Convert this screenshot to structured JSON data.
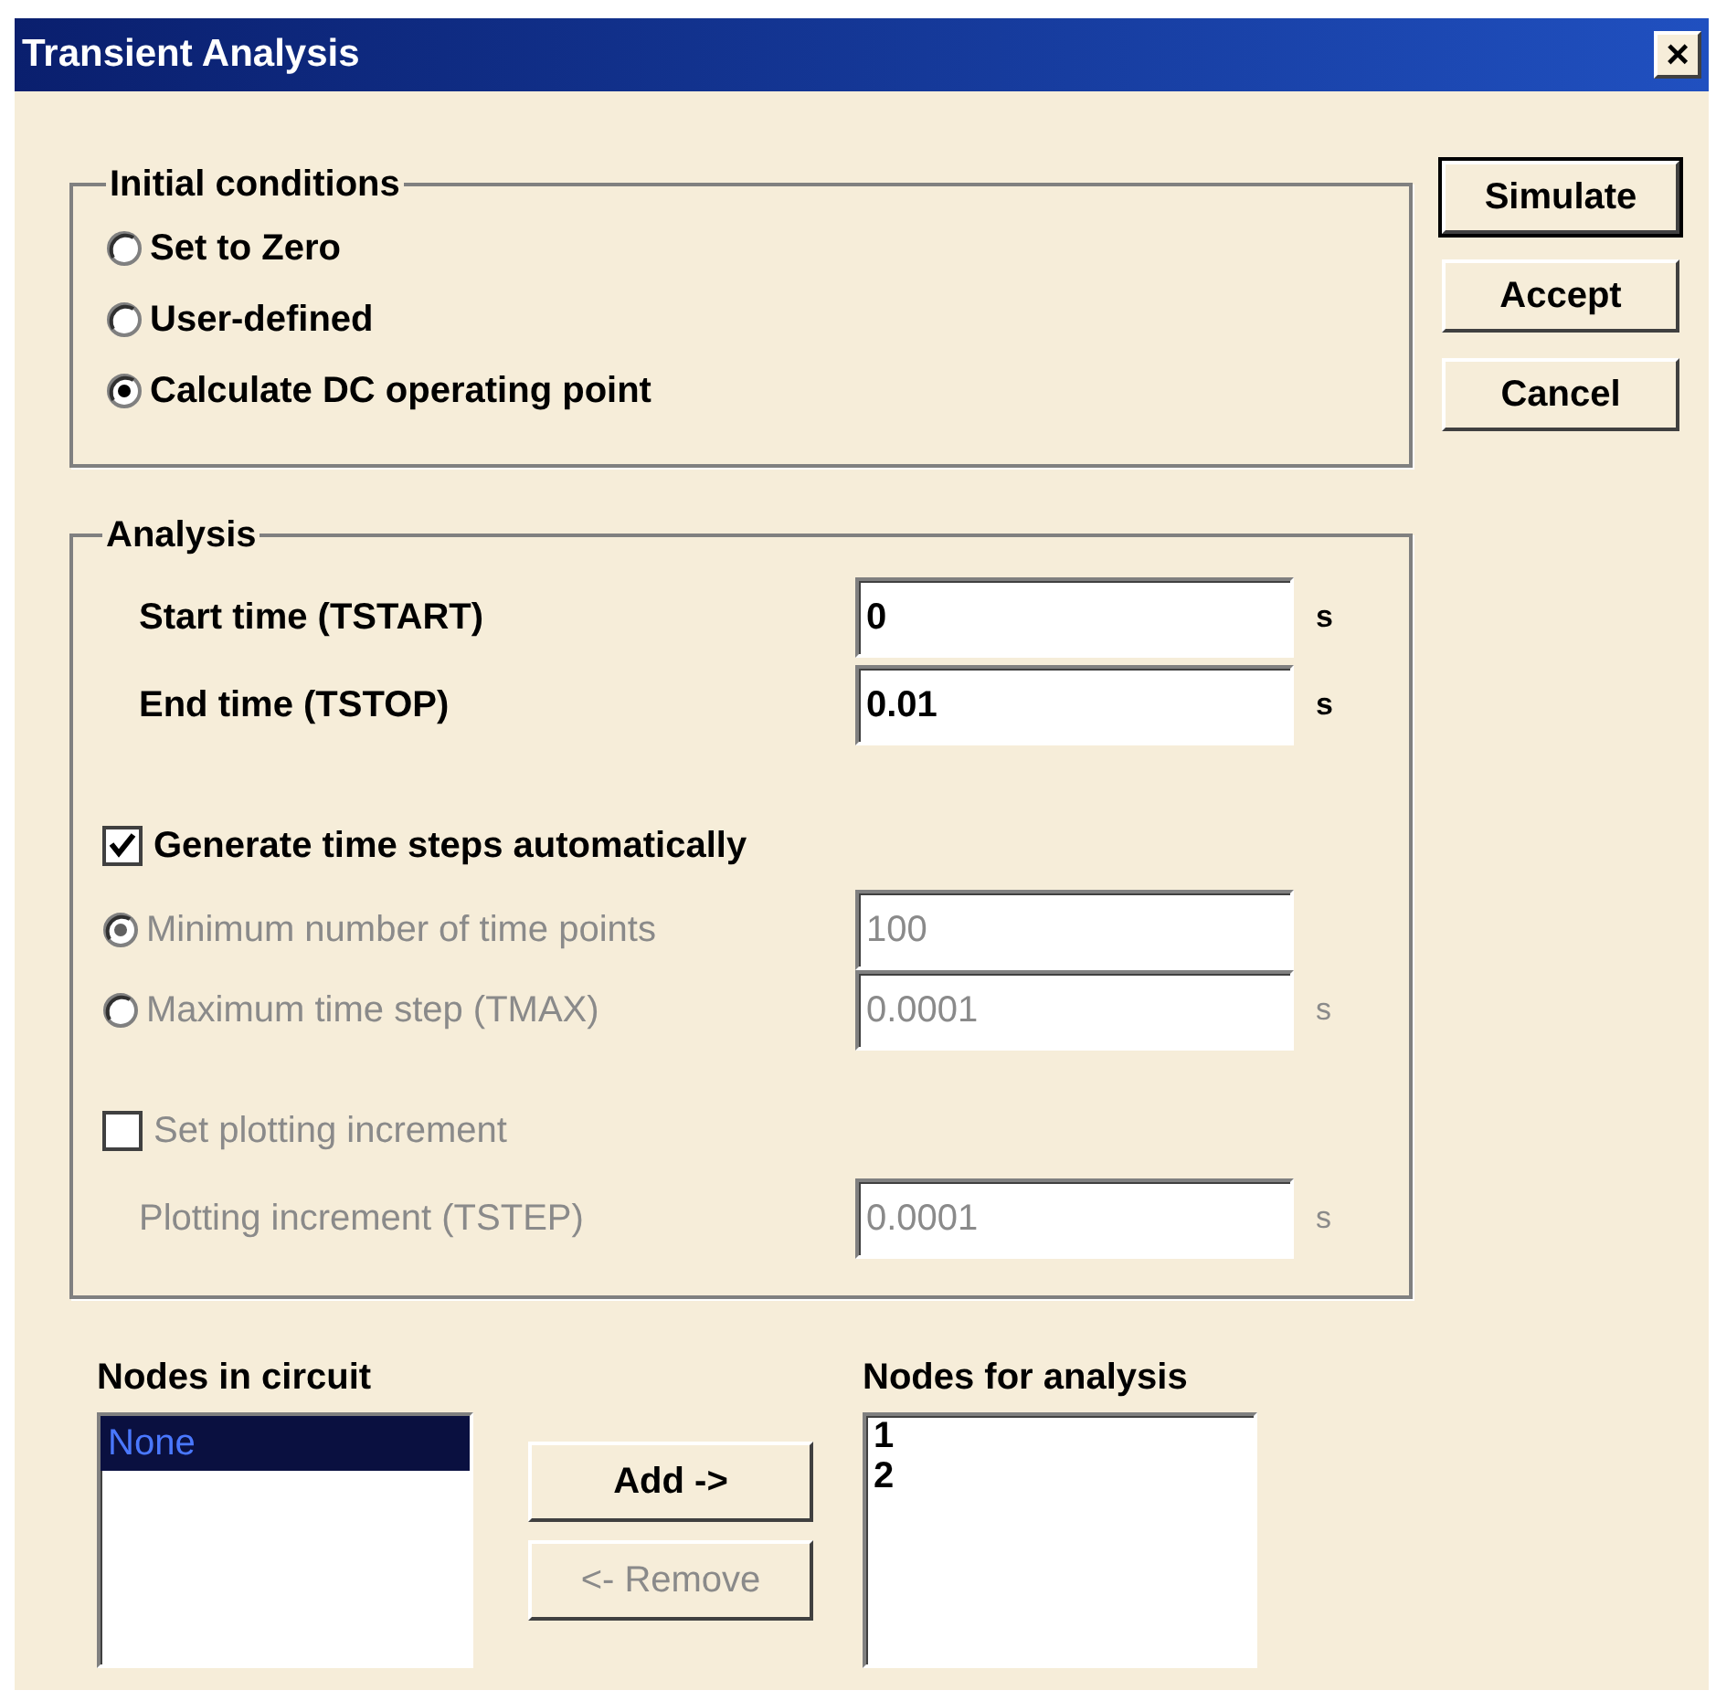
{
  "window": {
    "title": "Transient Analysis",
    "close": "×"
  },
  "buttons": [
    {
      "label": "Simulate",
      "default": true
    },
    {
      "label": "Accept",
      "default": false
    },
    {
      "label": "Cancel",
      "default": false
    }
  ],
  "initial_conditions": {
    "title": "Initial conditions",
    "options": [
      {
        "label": "Set to Zero",
        "selected": false
      },
      {
        "label": "User-defined",
        "selected": false
      },
      {
        "label": "Calculate DC operating point",
        "selected": true
      }
    ]
  },
  "analysis": {
    "title": "Analysis",
    "rows": [
      {
        "kind": "field",
        "label": "Start time (TSTART)",
        "value": "0",
        "unit": "s",
        "disabled": false
      },
      {
        "kind": "field",
        "label": "End time (TSTOP)",
        "value": "0.01",
        "unit": "s",
        "disabled": false
      },
      {
        "kind": "checkbox",
        "label": "Generate time steps automatically",
        "checked": true,
        "disabled": false
      },
      {
        "kind": "radio-field",
        "label": "Minimum number of time points",
        "selected": true,
        "value": "100",
        "disabled": true
      },
      {
        "kind": "radio-field",
        "label": "Maximum time step (TMAX)",
        "selected": false,
        "value": "0.0001",
        "unit": "s",
        "disabled": true
      },
      {
        "kind": "checkbox",
        "label": "Set plotting increment",
        "checked": false,
        "disabled": true
      },
      {
        "kind": "field",
        "label": "Plotting increment (TSTEP)",
        "value": "0.0001",
        "unit": "s",
        "disabled": true
      }
    ]
  },
  "nodes": {
    "in_circuit": {
      "title": "Nodes in circuit",
      "items": [
        {
          "label": "None",
          "selected": true
        }
      ]
    },
    "add": {
      "label": "Add ->",
      "disabled": false
    },
    "remove": {
      "label": "<- Remove",
      "disabled": true
    },
    "for_analysis": {
      "title": "Nodes for analysis",
      "items": [
        {
          "label": "1",
          "selected": false
        },
        {
          "label": "2",
          "selected": false
        }
      ]
    }
  }
}
